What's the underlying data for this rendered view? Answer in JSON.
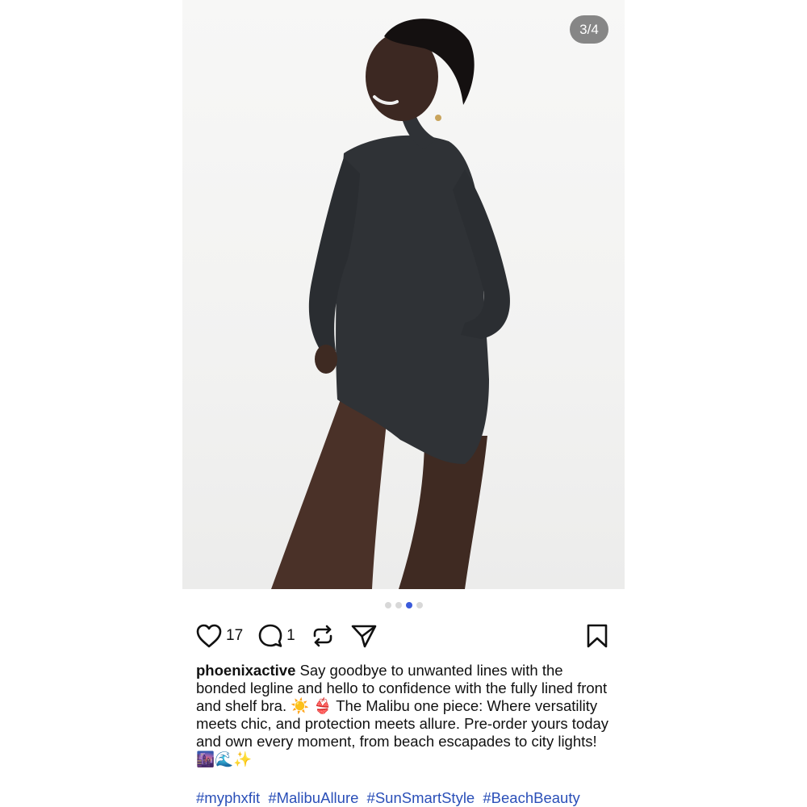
{
  "post": {
    "image_counter": "3/4",
    "carousel": {
      "total": 4,
      "active_index": 2
    },
    "actions": {
      "like_count": "17",
      "comment_count": "1"
    },
    "caption": {
      "username": "phoenixactive",
      "text": "Say goodbye to unwanted lines with the bonded legline and hello to confidence with the fully lined front and shelf bra. ☀️ 👙 The Malibu one piece: Where versatility meets chic, and protection meets allure. Pre-order yours today and own every moment, from beach escapades to city lights! 🌆🌊✨"
    },
    "hashtags": [
      "#myphxfit",
      "#MalibuAllure",
      "#SunSmartStyle",
      "#BeachBeauty"
    ]
  },
  "icons": {
    "like": "heart-icon",
    "comment": "comment-bubble-icon",
    "repost": "repost-icon",
    "share": "send-icon",
    "save": "bookmark-icon"
  },
  "colors": {
    "hashtag": "#2a4fb8",
    "active_dot": "#3b5bdb",
    "counter_bg": "#5a5a5a"
  }
}
